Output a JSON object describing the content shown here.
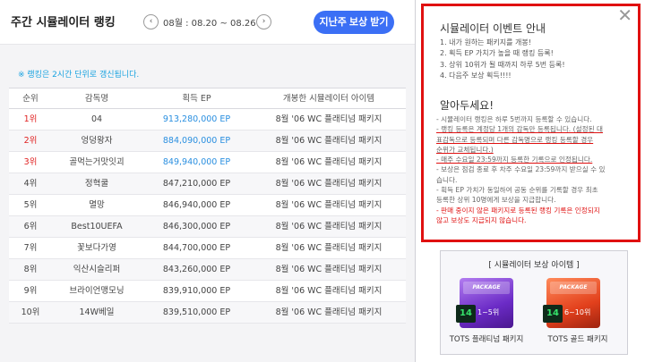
{
  "header": {
    "title": "주간 시뮬레이터 랭킹",
    "date_range": "08월 : 08.20 ~ 08.26",
    "reward_button": "지난주 보상 받기",
    "prev_symbol": "‹",
    "next_symbol": "›"
  },
  "notice": "※ 랭킹은 2시간 단위로 갱신됩니다.",
  "table": {
    "columns": [
      "순위",
      "감독명",
      "획득 EP",
      "개봉한 시뮬레이터 아이템"
    ],
    "rows": [
      {
        "rank": "1위",
        "name": "04",
        "ep": "913,280,000 EP",
        "item": "8월 '06 WC 플래티넘 패키지"
      },
      {
        "rank": "2위",
        "name": "엉덩왕자",
        "ep": "884,090,000 EP",
        "item": "8월 '06 WC 플래티넘 패키지"
      },
      {
        "rank": "3위",
        "name": "골먹는거맛잇괴",
        "ep": "849,940,000 EP",
        "item": "8월 '06 WC 플래티넘 패키지"
      },
      {
        "rank": "4위",
        "name": "정혁쿨",
        "ep": "847,210,000 EP",
        "item": "8월 '06 WC 플래티넘 패키지"
      },
      {
        "rank": "5위",
        "name": "멸망",
        "ep": "846,940,000 EP",
        "item": "8월 '06 WC 플래티넘 패키지"
      },
      {
        "rank": "6위",
        "name": "Best10UEFA",
        "ep": "846,300,000 EP",
        "item": "8월 '06 WC 플래티넘 패키지"
      },
      {
        "rank": "7위",
        "name": "꽃보다가영",
        "ep": "844,700,000 EP",
        "item": "8월 '06 WC 플래티넘 패키지"
      },
      {
        "rank": "8위",
        "name": "익산시슬리퍼",
        "ep": "843,260,000 EP",
        "item": "8월 '06 WC 플래티넘 패키지"
      },
      {
        "rank": "9위",
        "name": "브라이언맹모닝",
        "ep": "839,910,000 EP",
        "item": "8월 '06 WC 플래티넘 패키지"
      },
      {
        "rank": "10위",
        "name": "14W베일",
        "ep": "839,510,000 EP",
        "item": "8월 '06 WC 플래티넘 패키지"
      }
    ]
  },
  "event": {
    "close_symbol": "✕",
    "title": "시뮬레이터 이벤트 안내",
    "steps": [
      "1. 내가 원하는 패키지를 개봉!",
      "2. 획득 EP 가치가 높을 때 랭킹 등록!",
      "3. 상위 10위가 될 때까지 하루 5번 등록!",
      "4. 다음주 보상 획득!!!!"
    ],
    "know_title": "알아두세요!",
    "notes": [
      "- 시뮬레이터 랭킹은 하루 5번까지 등록할 수 있습니다.",
      "- 랭킹 등록은 계정당 1개의 감독만 등록됩니다. (설정된 대",
      "  표감독으로 등록되며 다른 감독명으로 랭킹 등록할 경우",
      "  순위가 교체됩니다.)",
      "- 매주 수요일 23:59까지 등록한 기록으로 인정됩니다.",
      "- 보상은 점검 종료 후 차주 수요일 23:59까지 받으실 수 있",
      "  습니다.",
      "- 획득 EP 가치가 동일하여 공동 순위를 기록할 경우 최초",
      "  등록한 상위 10명에게 보상을 지급합니다.",
      "- 판매 중이지 않은 패키지로 등록된 랭킹 기록은 인정되지",
      "  않고 보상도 지급되지 않습니다."
    ]
  },
  "reward": {
    "heading": "[ 시뮬레이터 보상 아이템 ]",
    "packs": [
      {
        "label": "1~5위",
        "name": "TOTS 플래티넘 패키지",
        "badge": "14",
        "lid": "PACKAGE"
      },
      {
        "label": "6~10위",
        "name": "TOTS 골드 패키지",
        "badge": "14",
        "lid": "PACKAGE"
      }
    ]
  }
}
